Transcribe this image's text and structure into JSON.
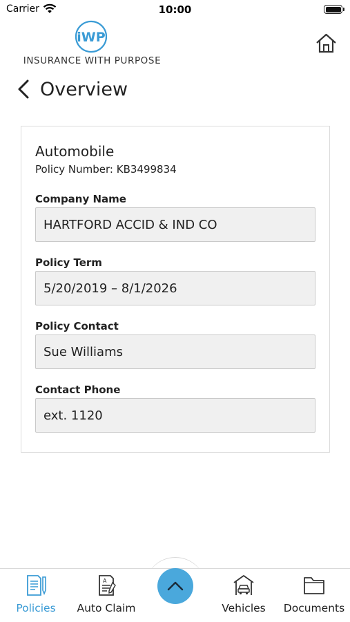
{
  "status_bar": {
    "carrier": "Carrier",
    "time": "10:00"
  },
  "header": {
    "logo_monogram": "iWP",
    "logo_text": "INSURANCE WITH PURPOSE",
    "home_icon": "home-icon"
  },
  "nav": {
    "back_icon": "chevron-left-icon",
    "title": "Overview"
  },
  "policy": {
    "type": "Automobile",
    "number_line": "Policy Number: KB3499834",
    "fields": [
      {
        "label": "Company Name",
        "value": "HARTFORD ACCID & IND CO"
      },
      {
        "label": "Policy Term",
        "value": "5/20/2019 – 8/1/2026"
      },
      {
        "label": "Policy Contact",
        "value": "Sue Williams"
      },
      {
        "label": "Contact Phone",
        "value": "ext. 1120"
      }
    ]
  },
  "tab_bar": {
    "tabs": [
      {
        "label": "Policies",
        "icon": "document-pen-icon",
        "active": true
      },
      {
        "label": "Auto Claim",
        "icon": "claim-form-icon",
        "active": false
      },
      {
        "label": "Vehicles",
        "icon": "garage-car-icon",
        "active": false
      },
      {
        "label": "Documents",
        "icon": "folder-icon",
        "active": false
      }
    ],
    "center_button_icon": "chevron-up-icon"
  },
  "colors": {
    "accent": "#3a9bd5",
    "fab": "#4aa8dc",
    "field_bg": "#f0f0f0",
    "border": "#dcdcdc"
  }
}
